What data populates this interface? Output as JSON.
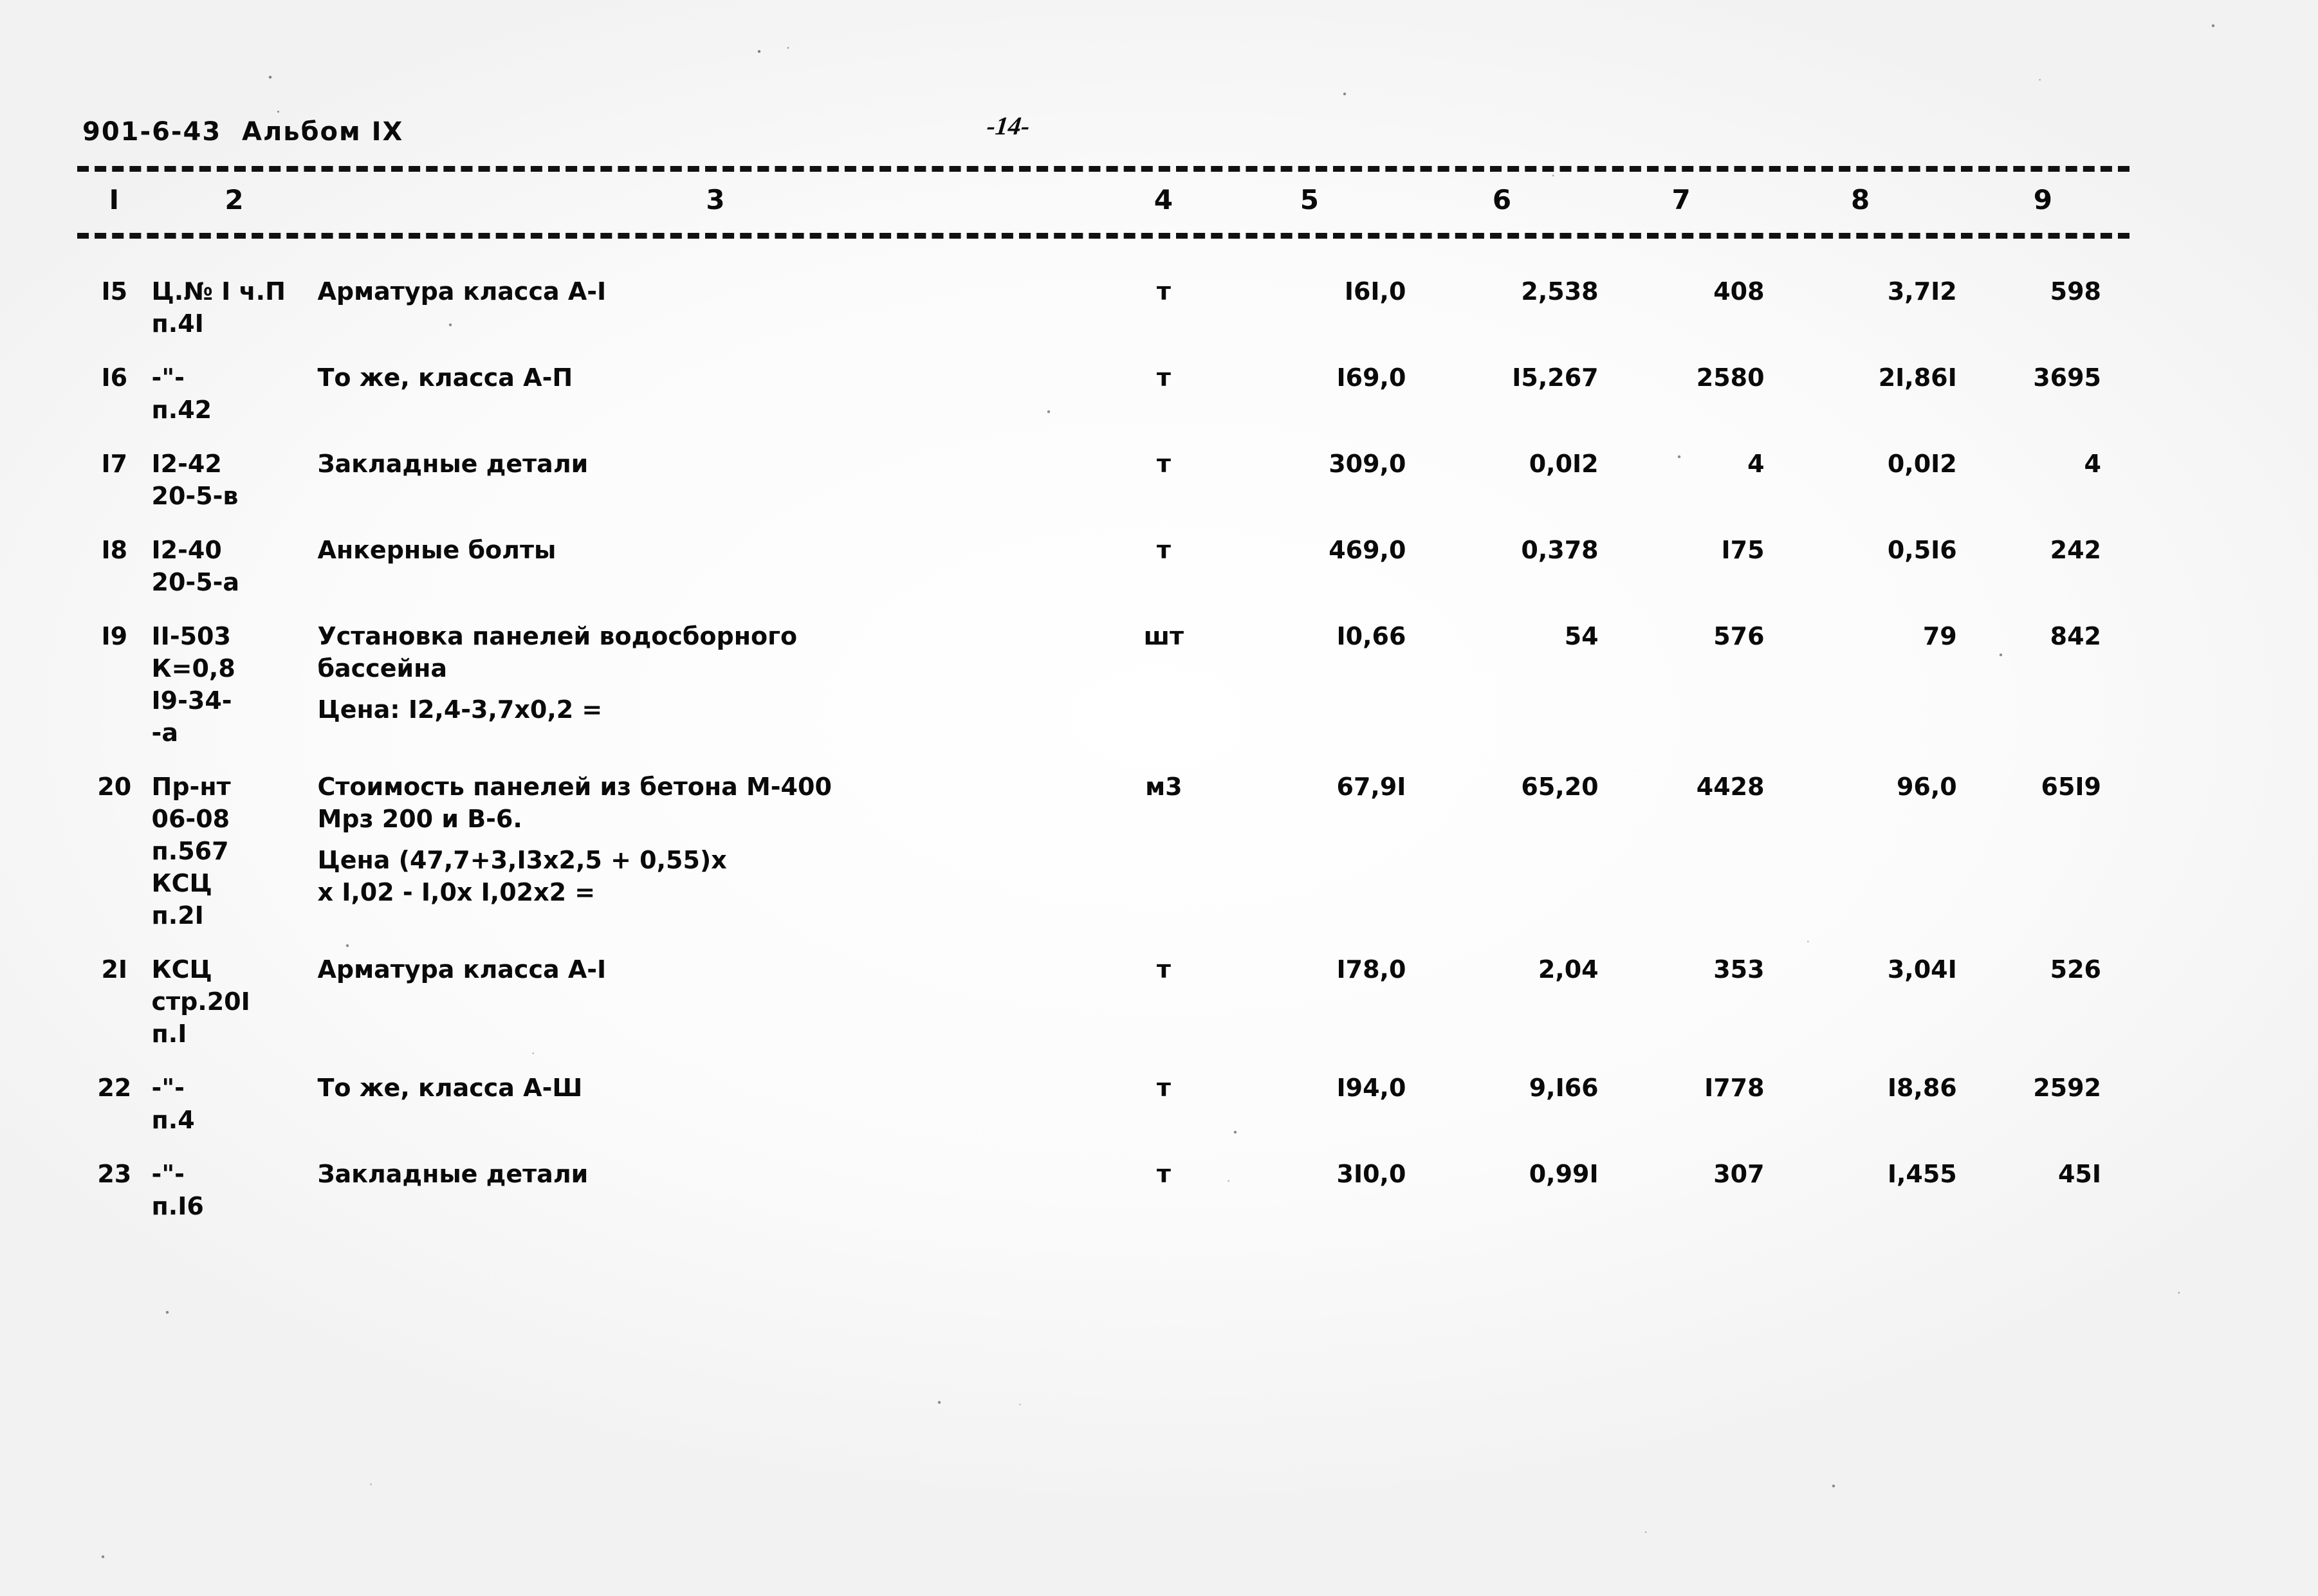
{
  "document": {
    "header_left": "901-6-43  Альбом IX",
    "page_number": "-14-"
  },
  "table": {
    "column_numbers": [
      "I",
      "2",
      "3",
      "4",
      "5",
      "6",
      "7",
      "8",
      "9"
    ],
    "rows": [
      {
        "num": "I5",
        "code": "Ц.№ I ч.П\nп.4I",
        "description": "Арматура класса А-I",
        "unit": "т",
        "c5": "I6I,0",
        "c6": "2,538",
        "c7": "408",
        "c8": "3,7I2",
        "c9": "598"
      },
      {
        "num": "I6",
        "code": "-\"-\nп.42",
        "description": "То же, класса А-П",
        "unit": "т",
        "c5": "I69,0",
        "c6": "I5,267",
        "c7": "2580",
        "c8": "2I,86I",
        "c9": "3695"
      },
      {
        "num": "I7",
        "code": "I2-42\n20-5-в",
        "description": "Закладные детали",
        "unit": "т",
        "c5": "309,0",
        "c6": "0,0I2",
        "c7": "4",
        "c8": "0,0I2",
        "c9": "4"
      },
      {
        "num": "I8",
        "code": "I2-40\n20-5-а",
        "description": "Анкерные болты",
        "unit": "т",
        "c5": "469,0",
        "c6": "0,378",
        "c7": "I75",
        "c8": "0,5I6",
        "c9": "242"
      },
      {
        "num": "I9",
        "code": "II-503\nК=0,8\nI9-34-\n-а",
        "description": "Установка панелей водосборного\nбассейна",
        "description_note": "Цена: I2,4-3,7х0,2 =",
        "unit": "шт",
        "c5": "I0,66",
        "c6": "54",
        "c7": "576",
        "c8": "79",
        "c9": "842"
      },
      {
        "num": "20",
        "code": "Пр-нт\n06-08\nп.567\nКСЦ\nп.2I",
        "description": "Стоимость панелей из бетона М-400\nМрз 200 и В-6.",
        "description_note": "Цена (47,7+3,I3х2,5 + 0,55)х\nх I,02 - I,0х I,02х2 =",
        "unit": "м3",
        "c5": "67,9I",
        "c6": "65,20",
        "c7": "4428",
        "c8": "96,0",
        "c9": "65I9"
      },
      {
        "num": "2I",
        "code": "КСЦ\nстр.20I\nп.I",
        "description": "Арматура класса А-I",
        "unit": "т",
        "c5": "I78,0",
        "c6": "2,04",
        "c7": "353",
        "c8": "3,04I",
        "c9": "526"
      },
      {
        "num": "22",
        "code": "-\"-\nп.4",
        "description": "То же, класса А-Ш",
        "unit": "т",
        "c5": "I94,0",
        "c6": "9,I66",
        "c7": "I778",
        "c8": "I8,86",
        "c9": "2592"
      },
      {
        "num": "23",
        "code": "-\"-\nп.I6",
        "description": "Закладные детали",
        "unit": "т",
        "c5": "3I0,0",
        "c6": "0,99I",
        "c7": "307",
        "c8": "I,455",
        "c9": "45I"
      }
    ]
  }
}
